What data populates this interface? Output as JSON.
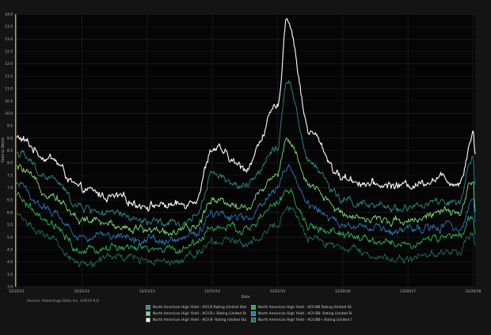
{
  "chart_data": {
    "type": "line",
    "xlabel": "Date",
    "ylabel": "Yield to Worst",
    "ylim": [
      3.0,
      14.0
    ],
    "yticks": [
      "3.0",
      "3.5",
      "4.0",
      "4.5",
      "5.0",
      "5.5",
      "6.0",
      "6.5",
      "7.0",
      "7.5",
      "8.0",
      "8.5",
      "9.0",
      "9.5",
      "10.0",
      "10.5",
      "11.0",
      "11.5",
      "12.0",
      "12.5",
      "13.0",
      "13.5",
      "14.0"
    ],
    "x_range": [
      "12/22/11",
      "12/31/18"
    ],
    "xticks": [
      "12/22/11",
      "12/21/12",
      "12/21/13",
      "12/21/14",
      "12/21/15",
      "12/20/16",
      "12/20/17",
      "12/20/18"
    ],
    "grid": true,
    "series": [
      {
        "name": "North American High Yield - ACII B- Rating (United States Dollar)",
        "color": "#ffffff",
        "x": [
          "12/22/11",
          "06/22/12",
          "12/21/12",
          "06/21/13",
          "12/21/13",
          "06/21/14",
          "09/21/14",
          "12/21/14",
          "06/21/15",
          "12/21/15",
          "02/11/16",
          "06/21/16",
          "12/20/16",
          "06/20/17",
          "12/20/17",
          "06/20/18",
          "10/01/18",
          "12/20/18",
          "12/31/18"
        ],
        "values": [
          9.0,
          8.2,
          6.9,
          6.6,
          6.3,
          6.3,
          6.6,
          8.6,
          7.8,
          10.2,
          13.9,
          9.2,
          7.4,
          7.1,
          7.1,
          7.4,
          7.2,
          9.2,
          8.4
        ]
      },
      {
        "name": "North American High Yield - ACII B Rating (United States Dollar)",
        "color": "#2b8f8a",
        "x": [
          "12/22/11",
          "06/22/12",
          "12/21/12",
          "06/21/13",
          "12/21/13",
          "06/21/14",
          "09/21/14",
          "12/21/14",
          "06/21/15",
          "12/21/15",
          "02/11/16",
          "06/21/16",
          "12/20/16",
          "06/20/17",
          "12/20/17",
          "06/20/18",
          "10/01/18",
          "12/20/18",
          "12/31/18"
        ],
        "values": [
          8.4,
          7.4,
          6.2,
          5.9,
          5.6,
          5.5,
          5.9,
          7.6,
          7.0,
          8.7,
          11.4,
          8.0,
          6.5,
          6.2,
          6.2,
          6.4,
          6.3,
          8.2,
          7.1
        ]
      },
      {
        "name": "North American High Yield - ACII B+ Rating (United States Dollar)",
        "color": "#7ee07a",
        "x": [
          "12/22/11",
          "06/22/12",
          "12/21/12",
          "06/21/13",
          "12/21/13",
          "06/21/14",
          "09/21/14",
          "12/21/14",
          "06/21/15",
          "12/21/15",
          "02/11/16",
          "06/21/16",
          "12/20/16",
          "06/20/17",
          "12/20/17",
          "06/20/18",
          "10/01/18",
          "12/20/18",
          "12/31/18"
        ],
        "values": [
          7.8,
          6.8,
          5.7,
          5.5,
          5.3,
          5.2,
          5.4,
          6.6,
          6.2,
          7.6,
          9.0,
          7.0,
          6.0,
          5.7,
          5.7,
          6.0,
          5.9,
          7.4,
          6.2
        ]
      },
      {
        "name": "North American High Yield - ACII BB Rating (United States Dollar)",
        "color": "#2fb35c",
        "x": [
          "12/22/11",
          "06/22/12",
          "12/21/12",
          "06/21/13",
          "12/21/13",
          "06/21/14",
          "09/21/14",
          "12/21/14",
          "06/21/15",
          "12/21/15",
          "02/11/16",
          "06/21/16",
          "12/20/16",
          "06/20/17",
          "12/20/17",
          "06/20/18",
          "10/01/18",
          "12/20/18",
          "12/31/18"
        ],
        "values": [
          6.6,
          5.5,
          4.4,
          4.6,
          4.5,
          4.5,
          4.8,
          5.4,
          5.3,
          6.3,
          6.9,
          5.4,
          5.1,
          4.8,
          4.7,
          5.0,
          5.0,
          5.8,
          5.2
        ]
      },
      {
        "name": "North American High Yield - ACII BB+ Rating (United States Dollar)",
        "color": "#1f6f5c",
        "x": [
          "12/22/11",
          "06/22/12",
          "12/21/12",
          "06/21/13",
          "12/21/13",
          "06/21/14",
          "09/21/14",
          "12/21/14",
          "06/21/15",
          "12/21/15",
          "02/11/16",
          "06/21/16",
          "12/20/16",
          "06/20/17",
          "12/20/17",
          "06/20/18",
          "10/01/18",
          "12/20/18",
          "12/31/18"
        ],
        "values": [
          5.9,
          4.9,
          3.9,
          4.2,
          4.1,
          4.1,
          4.4,
          4.9,
          4.8,
          5.5,
          6.3,
          4.9,
          4.6,
          4.2,
          4.1,
          4.4,
          4.4,
          5.3,
          4.7
        ]
      },
      {
        "name": "North American High Yield - ACII BB- Rating (United States Dollar)",
        "color": "#2a78b8",
        "x": [
          "12/22/11",
          "06/22/12",
          "12/21/12",
          "06/21/13",
          "12/21/13",
          "06/21/14",
          "09/21/14",
          "12/21/14",
          "06/21/15",
          "12/21/15",
          "02/11/16",
          "06/21/16",
          "12/20/16",
          "06/20/17",
          "12/20/17",
          "06/20/18",
          "10/01/18",
          "12/20/18",
          "12/31/18"
        ],
        "values": [
          7.1,
          6.1,
          5.0,
          5.1,
          4.9,
          4.9,
          5.1,
          6.0,
          5.8,
          6.9,
          7.9,
          6.2,
          5.5,
          5.3,
          5.2,
          5.4,
          5.4,
          6.6,
          5.7
        ]
      }
    ],
    "legend_order": [
      1,
      3,
      2,
      5,
      0,
      4
    ],
    "source": "Source: Advantage Data Inc. 4/4/19 9:0"
  }
}
